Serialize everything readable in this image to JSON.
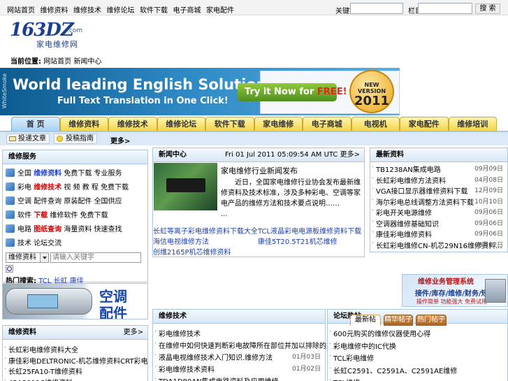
{
  "topnav": [
    "网站首页",
    "维修资料",
    "维修技术",
    "维修论坛",
    "软件下载",
    "电子商城",
    "家电配件"
  ],
  "search": {
    "label1": "关键字:",
    "label2": "栏目:",
    "btn": "搜 索"
  },
  "logo": {
    "main": "163DZ",
    "com": ".com",
    "sub": "家电维修网"
  },
  "location": {
    "label": "当前位置:",
    "path": "网站首页 新闻中心"
  },
  "banner": {
    "brand": "WhiteSmoke",
    "headline": "World leading English Solutions",
    "subline": "Full Text Translation in One Click!",
    "cta_prefix": "Try it Now for ",
    "cta_free": "FREE!",
    "seal_top": "NEW VERSION",
    "seal_year": "2011"
  },
  "tabs": [
    "首 页",
    "维修资料",
    "维修技术",
    "维修论坛",
    "软件下载",
    "家电维修",
    "电子商城",
    "电视机",
    "家电配件",
    "维修培训"
  ],
  "subbar": {
    "submit": "投递文章",
    "guide": "投稿指南",
    "more": "更多>"
  },
  "services": {
    "title": "维修服务",
    "rows": [
      {
        "a": "全国",
        "b": "维修资料",
        "c": "免费下载 专业服务",
        "bclass": "blue"
      },
      {
        "a": "彩电",
        "b": "维修技术",
        "c": "视 频 教 程 免费下载",
        "bclass": "red"
      },
      {
        "a": "空调",
        "b": "配件查询",
        "c": "原装配件 全国供应",
        "bclass": "plain"
      },
      {
        "a": "软件",
        "b": "下载",
        "c": "维修软件 免费下载",
        "bclass": "red"
      },
      {
        "a": "电路",
        "b": "图纸查询",
        "c": "海量资料 快速查找",
        "bclass": "red"
      },
      {
        "a": "技术",
        "b": "论坛交流",
        "c": "",
        "bclass": "plain"
      }
    ],
    "select": "维修资料",
    "input_placeholder": "请输入关键字",
    "hot_label": "热门搜索:",
    "hot": [
      "TCL",
      "长虹",
      "康佳"
    ]
  },
  "ad_left": {
    "t1": "空调",
    "t2": "配件"
  },
  "news": {
    "title": "新闻中心",
    "date": "Fri 01 Jul 2011 05:09:54 AM UTC",
    "more": "更多>",
    "headline": "家电维修行业新闻发布",
    "summary": "近日，全国家电维修行业协会发布最新维修资料及技术标准，涉及多种彩电、空调等家电产品的维修方法和技术要点说明……",
    "ellipsis": "...",
    "links": [
      {
        "t": "长虹等离子彩电维修资料下载大全",
        "x": 0,
        "y": 0
      },
      {
        "t": "TCL液晶彩电电源板维修资料下载",
        "x": 1,
        "y": 0
      },
      {
        "t": "海信电视维修方法",
        "x": 0,
        "y": 1
      },
      {
        "t": "康佳5T20.5T21机芯维修",
        "x": 1,
        "y": 1
      },
      {
        "t": "创维2165P机芯维修资料",
        "x": 0,
        "y": 2
      }
    ]
  },
  "latest": {
    "title": "最新资料",
    "items": [
      {
        "t": "TB1238AN集成电路",
        "d": "09月09日"
      },
      {
        "t": "长虹彩电维修方法资料",
        "d": "04月08日"
      },
      {
        "t": "VGA接口显示器维修资料下载",
        "d": "12月09日"
      },
      {
        "t": "海尔彩电总线调整方法资料下载",
        "d": "10月10日"
      },
      {
        "t": "彩电开关电源维修",
        "d": "09月06日"
      },
      {
        "t": "空调器维修基础知识",
        "d": "09月06日"
      },
      {
        "t": "康佳彩电维修资料",
        "d": "09月06日"
      },
      {
        "t": "长虹彩电维修CN-机芯29N16维修资料...",
        "d": "08月02日"
      }
    ]
  },
  "ad_right": {
    "a": "维修业务管理系统",
    "b": "接件/库存/维修/财务/短信",
    "c": "操作简单 功能强大 免费试用"
  },
  "repair": {
    "title": "维修资料",
    "more": "更多>",
    "items": [
      {
        "t": "长虹彩电维修资料大全",
        "d": ""
      },
      {
        "t": "康佳彩电DELTRONIC-机芯维修资料CRT彩电",
        "d": ""
      },
      {
        "t": "长虹25FA10-T维修资料",
        "d": ""
      },
      {
        "t": "42A3000C维修资料",
        "d": ""
      }
    ]
  },
  "tech": {
    "title": "维修技术",
    "items": [
      {
        "t": "彩电维修技术",
        "d": ""
      },
      {
        "t": "在维修中如何快速判断彩电故障所在部位并加以排除的方法与技巧介绍...",
        "d": ""
      },
      {
        "t": "液晶电视维修技术入门知识.维修方法",
        "d": "01月03日"
      },
      {
        "t": "彩电维修技术资料",
        "d": "01月02日"
      },
      {
        "t": "TDA1D80AN集成电路资料及应用维修",
        "d": ""
      }
    ]
  },
  "forum": {
    "title": "论坛热帖",
    "tabs": [
      "最新帖",
      "精华帖子",
      "热门帖子"
    ],
    "items": [
      "600元购买的维修仪器使用心得",
      "彩电维修中的IC代换",
      "TCL彩电维修",
      "长虹C2591、C2591A、C2591AE维修",
      "TCL维修"
    ]
  }
}
